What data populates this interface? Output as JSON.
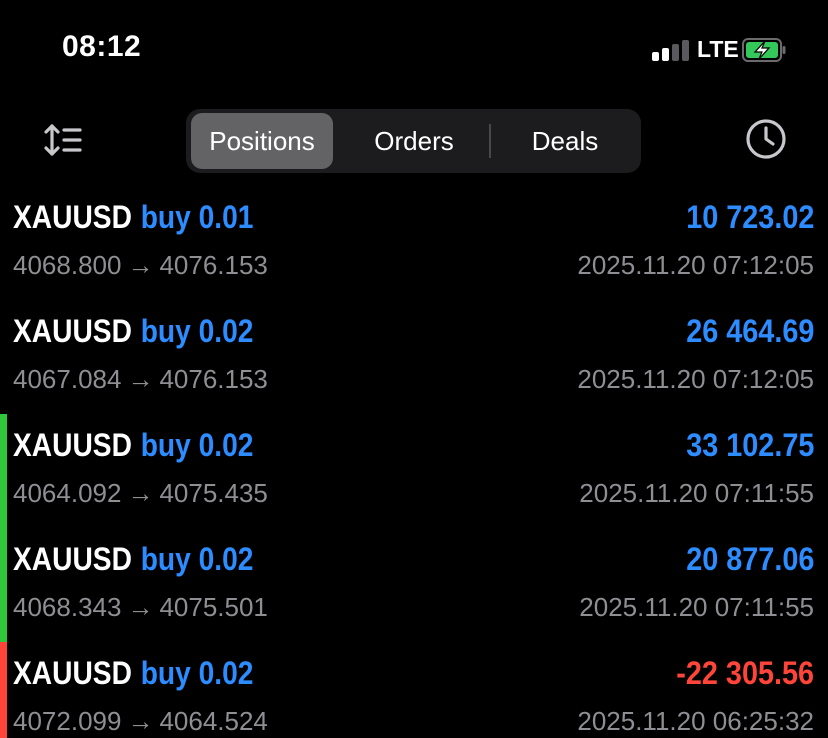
{
  "status_bar": {
    "time": "08:12",
    "network": "LTE",
    "signal_bars_active": 2,
    "battery_charging": true,
    "colors": {
      "battery_fill": "#34c759"
    }
  },
  "toolbar": {
    "sort_icon": "sort-icon",
    "history_icon": "clock-icon",
    "tabs": [
      {
        "label": "Positions",
        "active": true
      },
      {
        "label": "Orders",
        "active": false
      },
      {
        "label": "Deals",
        "active": false
      }
    ]
  },
  "colors": {
    "buy": "#2d8cff",
    "profit_positive": "#2d8cff",
    "profit_negative": "#ff453a",
    "indicator_green": "#30c83a",
    "indicator_red": "#ff453a",
    "secondary_text": "#8e8e93"
  },
  "positions": [
    {
      "symbol": "XAUUSD",
      "side": "buy",
      "volume": "0.01",
      "open_price": "4068.800",
      "arrow": "→",
      "current_price": "4076.153",
      "profit": "10 723.02",
      "time": "2025.11.20 07:12:05",
      "profit_color": "#2d8cff",
      "indicator_color": ""
    },
    {
      "symbol": "XAUUSD",
      "side": "buy",
      "volume": "0.02",
      "open_price": "4067.084",
      "arrow": "→",
      "current_price": "4076.153",
      "profit": "26 464.69",
      "time": "2025.11.20 07:12:05",
      "profit_color": "#2d8cff",
      "indicator_color": ""
    },
    {
      "symbol": "XAUUSD",
      "side": "buy",
      "volume": "0.02",
      "open_price": "4064.092",
      "arrow": "→",
      "current_price": "4075.435",
      "profit": "33 102.75",
      "time": "2025.11.20 07:11:55",
      "profit_color": "#2d8cff",
      "indicator_color": "#30c83a"
    },
    {
      "symbol": "XAUUSD",
      "side": "buy",
      "volume": "0.02",
      "open_price": "4068.343",
      "arrow": "→",
      "current_price": "4075.501",
      "profit": "20 877.06",
      "time": "2025.11.20 07:11:55",
      "profit_color": "#2d8cff",
      "indicator_color": "#30c83a"
    },
    {
      "symbol": "XAUUSD",
      "side": "buy",
      "volume": "0.02",
      "open_price": "4072.099",
      "arrow": "→",
      "current_price": "4064.524",
      "profit": "-22 305.56",
      "time": "2025.11.20 06:25:32",
      "profit_color": "#ff453a",
      "indicator_color": "#ff453a"
    }
  ]
}
